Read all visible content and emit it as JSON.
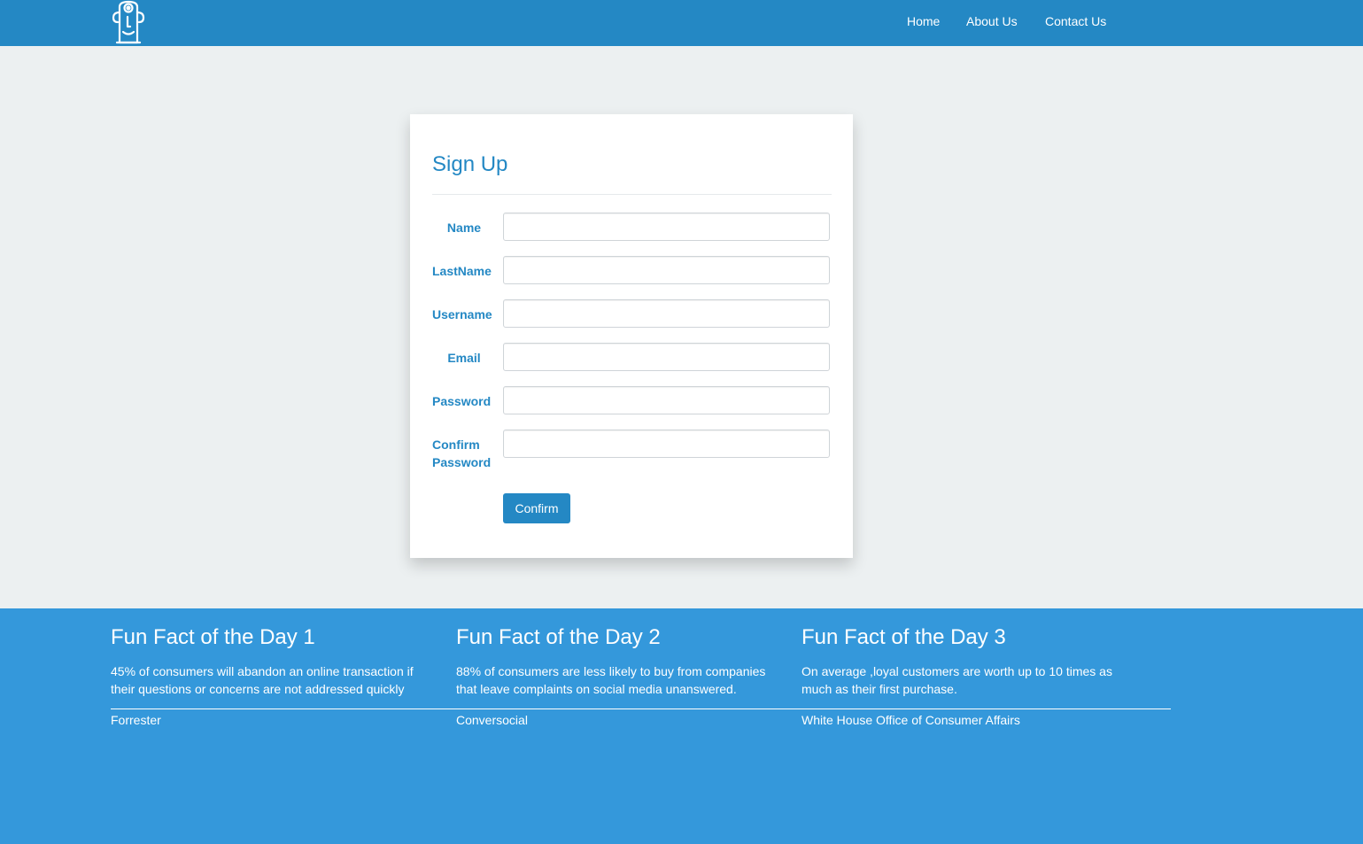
{
  "nav": {
    "logo_icon": "robot-face-logo",
    "items": [
      {
        "label": "Home"
      },
      {
        "label": "About Us"
      },
      {
        "label": "Contact Us"
      }
    ]
  },
  "signup": {
    "title": "Sign Up",
    "fields": {
      "name": {
        "label": "Name",
        "value": ""
      },
      "lastname": {
        "label": "LastName",
        "value": ""
      },
      "username": {
        "label": "Username",
        "value": ""
      },
      "email": {
        "label": "Email",
        "value": ""
      },
      "password": {
        "label": "Password",
        "value": ""
      },
      "confirm_password": {
        "label_line1": "Confirm",
        "label_line2": "Password",
        "value": ""
      }
    },
    "submit_label": "Confirm"
  },
  "footer": {
    "facts": [
      {
        "title": "Fun Fact of the Day 1",
        "text": "45% of consumers will abandon an online transaction if their questions or concerns are not addressed quickly",
        "source": "Forrester"
      },
      {
        "title": "Fun Fact of the Day 2",
        "text": "88% of consumers are less likely to buy from companies that leave complaints on social media unanswered.",
        "source": "Conversocial"
      },
      {
        "title": "Fun Fact of the Day 3",
        "text": "On average ,loyal customers are worth up to 10 times as much as their first purchase.",
        "source": "White House Office of Consumer Affairs"
      }
    ]
  },
  "colors": {
    "header": "#2488c4",
    "footer": "#3498db",
    "page_background": "#ecf0f1",
    "accent": "#2488c4"
  }
}
